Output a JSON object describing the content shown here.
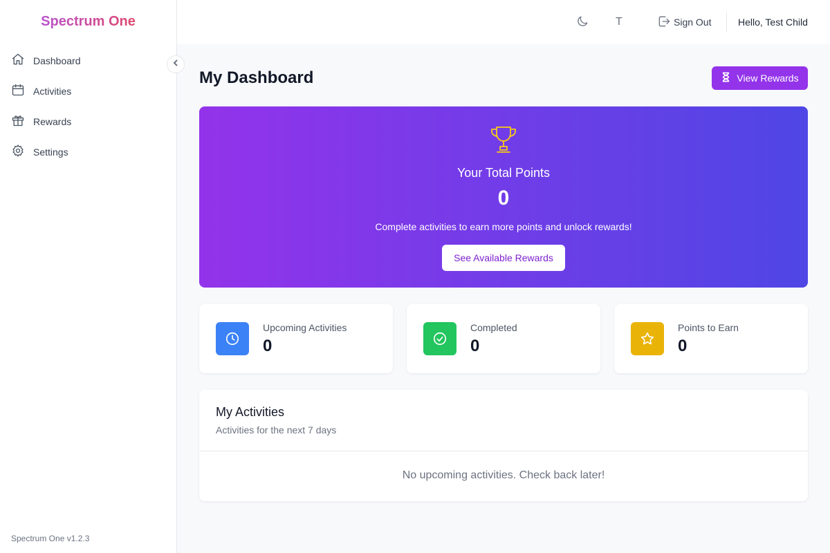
{
  "sidebar": {
    "brand": "Spectrum One",
    "items": [
      {
        "label": "Dashboard",
        "icon": "home-icon"
      },
      {
        "label": "Activities",
        "icon": "calendar-icon"
      },
      {
        "label": "Rewards",
        "icon": "gift-icon"
      },
      {
        "label": "Settings",
        "icon": "gear-icon"
      }
    ],
    "version": "Spectrum One v1.2.3"
  },
  "header": {
    "theme_icon": "moon-icon",
    "font_toggle": "T",
    "sign_out_label": "Sign Out",
    "greeting": "Hello, Test Child"
  },
  "main": {
    "title": "My Dashboard",
    "view_rewards_label": "View Rewards",
    "hero": {
      "label": "Your Total Points",
      "points": "0",
      "subtitle": "Complete activities to earn more points and unlock rewards!",
      "button_label": "See Available Rewards"
    },
    "stats": [
      {
        "label": "Upcoming Activities",
        "value": "0",
        "color": "#3b82f6",
        "icon": "clock-icon"
      },
      {
        "label": "Completed",
        "value": "0",
        "color": "#22c55e",
        "icon": "check-circle-icon"
      },
      {
        "label": "Points to Earn",
        "value": "0",
        "color": "#eab308",
        "icon": "star-icon"
      }
    ],
    "activities": {
      "title": "My Activities",
      "subtitle": "Activities for the next 7 days",
      "empty": "No upcoming activities. Check back later!"
    }
  },
  "colors": {
    "accent": "#9333ea",
    "hero_gradient_start": "#9333ea",
    "hero_gradient_end": "#4f46e5",
    "trophy": "#facc15"
  }
}
